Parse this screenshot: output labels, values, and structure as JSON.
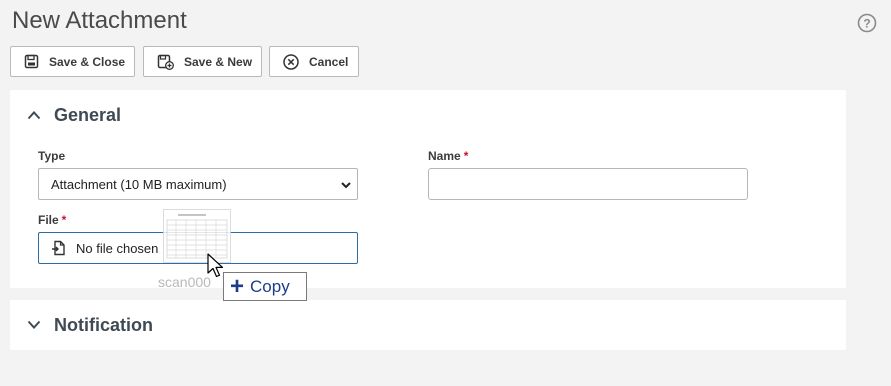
{
  "page": {
    "title": "New Attachment",
    "help_icon": "question-circle-icon"
  },
  "toolbar": {
    "save_close": "Save & Close",
    "save_new": "Save & New",
    "cancel": "Cancel"
  },
  "sections": {
    "general": {
      "title": "General",
      "expanded": true,
      "type_label": "Type",
      "type_value": "Attachment (10 MB maximum)",
      "name_label": "Name",
      "name_required": "*",
      "name_value": "",
      "file_label": "File",
      "file_required": "*",
      "file_value": "No file chosen"
    },
    "notification": {
      "title": "Notification",
      "expanded": false
    }
  },
  "drag": {
    "filename": "scan000",
    "action": "Copy"
  },
  "colors": {
    "accent": "#2b6ea5",
    "required": "#c8102e",
    "copy_text": "#1a3e8a"
  }
}
